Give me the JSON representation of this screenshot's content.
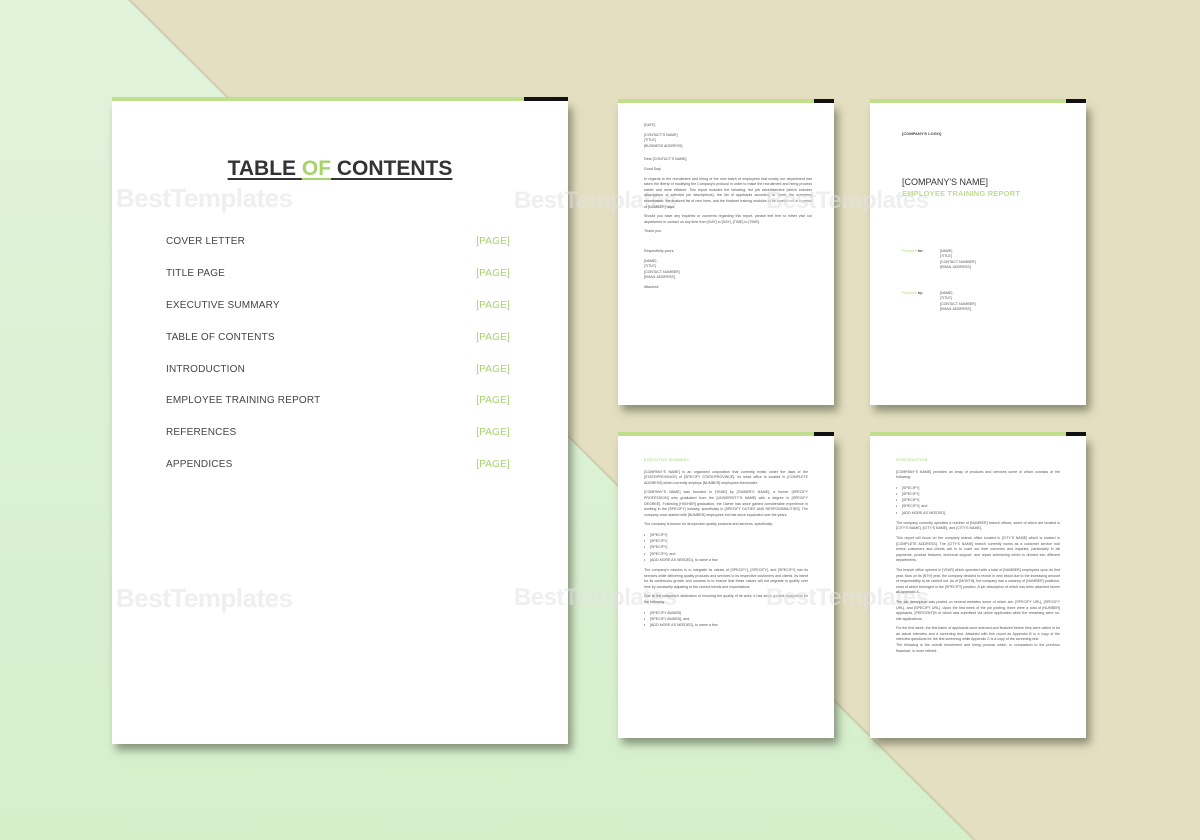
{
  "colors": {
    "accent_green": "#a6d36b",
    "top_bar_green": "#bfdf8c",
    "bg_green": "#d5efcb",
    "bg_beige": "#e5dfc1",
    "text_dark": "#333333"
  },
  "watermark": "BestTemplates",
  "toc_page": {
    "title_part1": "TABLE",
    "title_part2": "OF",
    "title_part3": "CONTENTS",
    "entries": [
      {
        "label": "COVER LETTER",
        "page": "[PAGE]"
      },
      {
        "label": "TITLE PAGE",
        "page": "[PAGE]"
      },
      {
        "label": "EXECUTIVE SUMMARY",
        "page": "[PAGE]"
      },
      {
        "label": "TABLE OF CONTENTS",
        "page": "[PAGE]"
      },
      {
        "label": "INTRODUCTION",
        "page": "[PAGE]"
      },
      {
        "label": "EMPLOYEE TRAINING REPORT",
        "page": "[PAGE]"
      },
      {
        "label": "REFERENCES",
        "page": "[PAGE]"
      },
      {
        "label": "APPENDICES",
        "page": "[PAGE]"
      }
    ]
  },
  "cover_letter": {
    "date": "[DATE]",
    "recipient": [
      "[CONTACT'S NAME]",
      "[TITLE]",
      "[BUSINESS ADDRESS]"
    ],
    "salutation": "Dear [CONTACT'S NAME],",
    "greeting": "Good Day!",
    "paragraph1": "In regards to the recruitment and hiring of the new batch of employees that mostly our department has taken the liberty of modifying the Company's protocol in order to make the recruitment and hiring process easier and more efficient. This report includes the following: the job advertisement (which includes descriptions of selected job descriptions), the list of applicants according to week, the screening examination, the finalized list of new hires, and the finalized training modules to be carried out in a period of [NUMBER] days.",
    "paragraph2": "Should you have any inquiries or concerns regarding this report, please feel free to either visit our department or contact us any time from [DAY] to [DAY], [TIME] to [TIME].",
    "thanks": "Thank you.",
    "closing": "Respectfully yours,",
    "sender": [
      "[NAME]",
      "[TITLE]",
      "[CONTACT NUMBER]",
      "[EMAIL ADDRESS]"
    ],
    "attached": "Attached:"
  },
  "title_page": {
    "logo": "[COMPANY'S LOGO]",
    "company": "[COMPANY'S NAME]",
    "report": "EMPLOYEE TRAINING REPORT",
    "prepared_for_label": "Prepared",
    "prepared_for_bold": "for:",
    "prepared_for": [
      "[NAME]",
      "[TITLE]",
      "[CONTACT NUMBER]",
      "[EMAIL ADDRESS]"
    ],
    "prepared_by_label": "Prepared",
    "prepared_by_bold": "by:",
    "prepared_by": [
      "[NAME]",
      "[TITLE]",
      "[CONTACT NUMBER]",
      "[EMAIL ADDRESS]"
    ]
  },
  "executive_summary": {
    "heading": "EXECUTIVE SUMMARY",
    "p1": "[COMPANY'S NAME] is an organized corporation that currently exists under the laws of the [STATE/PROVINCE] of [SPECIFY STATE/PROVINCE]. Its head office is located in [COMPLETE ADDRESS] which currently employs [NUMBER] employees thereunder.",
    "p2": "[COMPANY'S NAME] was founded in [YEAR] by [OWNER'S NAME], a former [SPECIFY PROFESSION] who graduated from the [UNIVERSITY'S NAME] with a degree in [SPECIFY DEGREE]. Following [HIS/HER] graduation, the Owner has since gained considerable experience in working in the [SPECIFY] industry, specifically in [SPECIFY DUTIES AND RESPONSIBILITIES]. The company once started with [NUMBER] employees but has since expanded over the years.",
    "p3": "The company is known for its topnotch quality products and services, specifically:",
    "list1": [
      "[SPECIFY]",
      "[SPECIFY]",
      "[SPECIFY]",
      "[SPECIFY]; and",
      "[ADD MORE AS NEEDED], to name a few."
    ],
    "p4": "The company's mission is to integrate its values of [SPECIFY], [SPECIFY], and [SPECIFY] into its services while delivering quality products and services to its respective customers and clients. Its intent for its continuous growth and success is to ensure that these values will not degrade in quality over time by constantly adjusting to the current trends and expectations.",
    "p5": "Due to the company's dedication of ensuring the quality of its work, it has since gained recognition for the following:",
    "list2": [
      "[SPECIFY AWARD]",
      "[SPECIFY AWARD]; and",
      "[ADD MORE AS NEEDED], to name a few."
    ]
  },
  "introduction": {
    "heading": "INTRODUCTION",
    "p1": "[COMPANY'S NAME] provides an array of products and services some of which consists of the following:",
    "list": [
      "[SPECIFY]",
      "[SPECIFY]",
      "[SPECIFY]",
      "[SPECIFY]; and",
      "[ADD MORE AS NEEDED]."
    ],
    "p2": "The company currently operates a number of [NUMBER] branch offices, some of which are located in [CITY'S NAME], [CITY'S NAME], and [CITY'S NAME].",
    "p3": "This report will focus on the company branch office located in [CITY'S NAME] which is located in [COMPLETE ADDRESS]. The [CITY'S NAME] branch currently works as a customer service hub where customers and clients call in to voice out their concerns and inquiries, particularly in bill payments, product features, technical support, and repair scheduling which is divided into different departments.",
    "p4": "The branch office opened in [YEAR] which operated with a total of [NUMBER] employees upon its first year. Now on its [NTH] year, the company decided to recruit in new blood due to the increasing amount of responsibility to be carried out. As of [MONTH], the company has a vacancy of [NUMBER] positions, most of which belonged in the [SPECIFY] position. A job description of which has been attached herein as Appendix A.",
    "p5": "The job description was posted on several websites some of which are: [SPECIFY URL], [SPECIFY URL], and [SPECIFY URL]. Upon the first week of the job posting, there were a total of [NUMBER] applicants, [PERCENT]% of which was submitted via online application while the remaining were on-site applications.",
    "p6": "For the first week, the first batch of applicants were selected and finalized before they were called in for an actual interview and a screening test. Attached with this report as Appendix B is a copy of the interview questions for the first screening while Appendix C is a copy of the screening test.",
    "p7": "The following is the overall recruitment and hiring process which, in comparison to the previous flowchart, is more refined:"
  }
}
